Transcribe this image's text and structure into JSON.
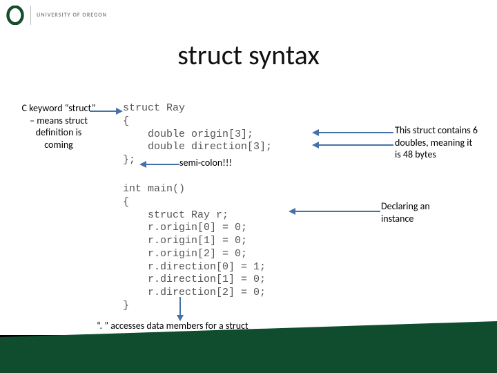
{
  "logo": {
    "text": "UNIVERSITY OF OREGON"
  },
  "title": "struct syntax",
  "annotations": {
    "keyword": "C keyword “struct” – means struct definition is coming",
    "semicolon": "semi-colon!!!",
    "contains": "This struct contains 6 doubles, meaning it is 48 bytes",
    "declaring": "Declaring an instance",
    "dot": "“. ” accesses data members for a struct"
  },
  "code": {
    "struct": "struct Ray\n{\n    double origin[3];\n    double direction[3];\n};",
    "main": "int main()\n{\n    struct Ray r;\n    r.origin[0] = 0;\n    r.origin[1] = 0;\n    r.origin[2] = 0;\n    r.direction[0] = 1;\n    r.direction[1] = 0;\n    r.direction[2] = 0;\n}"
  }
}
